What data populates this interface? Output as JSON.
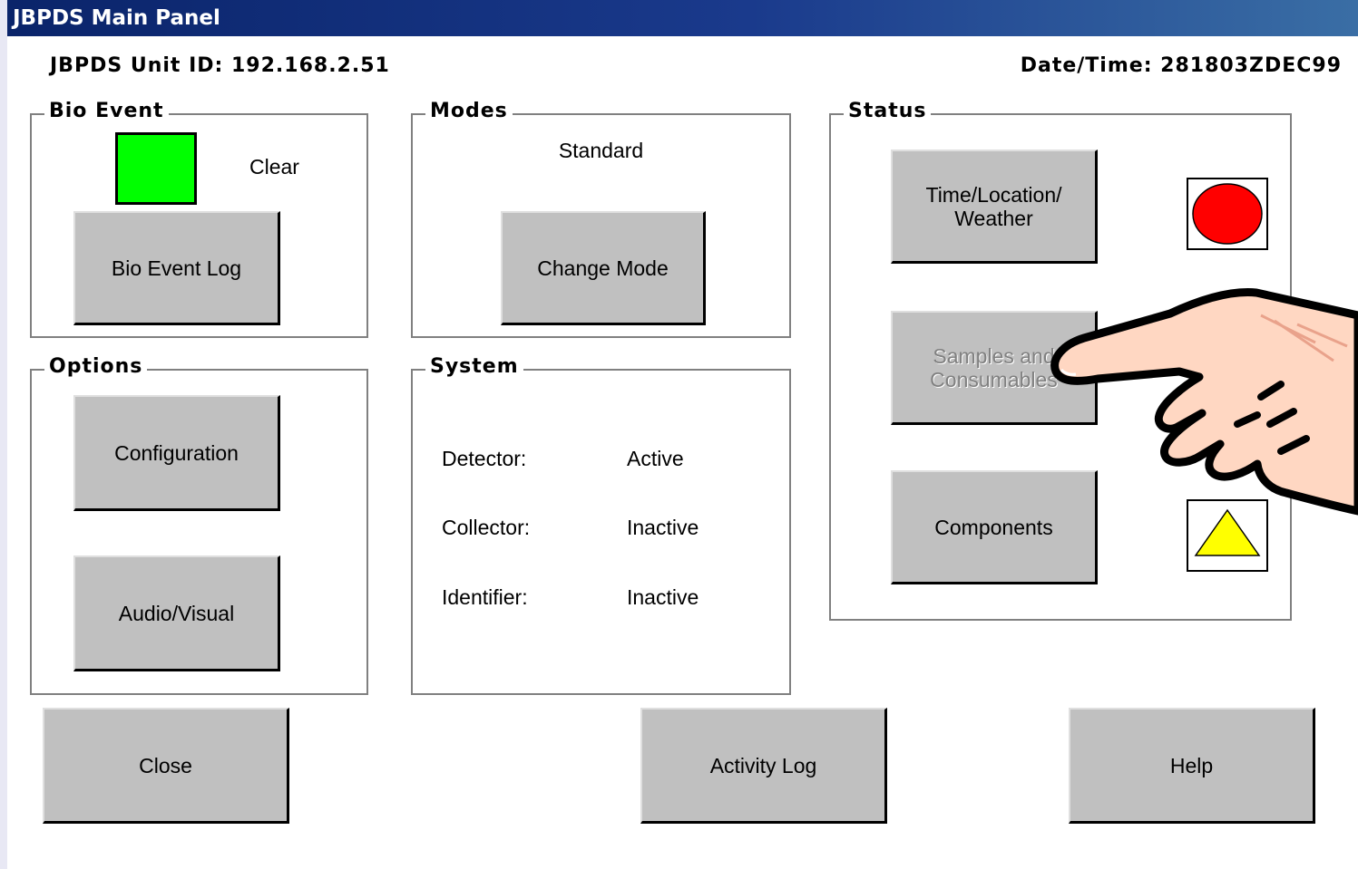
{
  "window": {
    "title": "JBPDS Main Panel"
  },
  "header": {
    "unit_id": "JBPDS Unit ID: 192.168.2.51",
    "datetime": "Date/Time: 281803ZDEC99"
  },
  "bio_event": {
    "legend": "Bio Event",
    "state": "Clear",
    "state_color": "#00ff00",
    "log_button": "Bio Event Log"
  },
  "modes": {
    "legend": "Modes",
    "current": "Standard",
    "change_button": "Change Mode"
  },
  "options": {
    "legend": "Options",
    "config_button": "Configuration",
    "av_button": "Audio/Visual"
  },
  "system": {
    "legend": "System",
    "rows": [
      {
        "label": "Detector:",
        "value": "Active"
      },
      {
        "label": "Collector:",
        "value": "Inactive"
      },
      {
        "label": "Identifier:",
        "value": "Inactive"
      }
    ]
  },
  "status": {
    "legend": "Status",
    "items": [
      {
        "button": "Time/Location/ Weather",
        "indicator": "red-circle",
        "color": "#ff0000"
      },
      {
        "button": "Samples and Consumables",
        "enabled": false
      },
      {
        "button": "Components",
        "indicator": "yellow-triangle",
        "color": "#ffff00"
      }
    ]
  },
  "footer": {
    "close_button": "Close",
    "activity_button": "Activity Log",
    "help_button": "Help"
  }
}
